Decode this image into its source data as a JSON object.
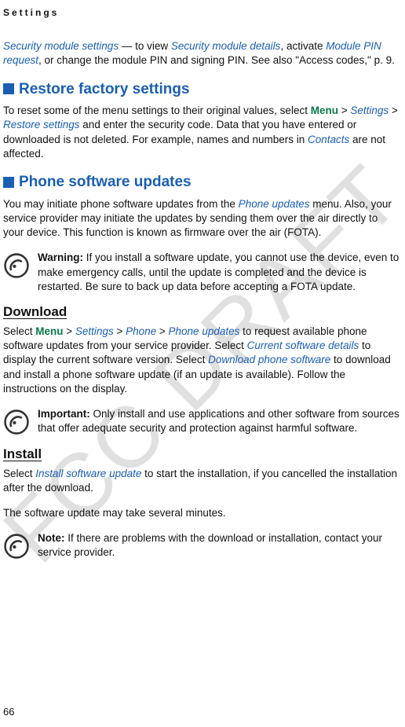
{
  "header": "Settings",
  "watermark": "FCC DRAFT",
  "page_number": "66",
  "intro": {
    "t1": "Security module settings",
    "t2": " — to view ",
    "t3": "Security module details",
    "t4": ", activate ",
    "t5": "Module PIN request",
    "t6": ", or change the module PIN and signing PIN. See also \"Access codes,\" p. 9."
  },
  "restore": {
    "title": "Restore factory settings",
    "p1a": "To reset some of the menu settings to their original values, select ",
    "menu": "Menu",
    "sep": " > ",
    "p1b": "Settings",
    "p1c": "Restore settings",
    "p1d": " and enter the security code. Data that you have entered or downloaded is not deleted. For example, names and numbers in ",
    "p1e": "Contacts",
    "p1f": " are not affected."
  },
  "updates": {
    "title": "Phone software updates",
    "p1a": "You may initiate phone software updates from the ",
    "p1b": "Phone updates",
    "p1c": " menu. Also, your service provider may initiate the updates by sending them over the air directly to your device. This function is known as firmware over the air (FOTA).",
    "warn_label": "Warning: ",
    "warn_text": "If you install a software update, you cannot use the device, even to make emergency calls, until the update is completed and the device is restarted. Be sure to back up data before accepting a FOTA update."
  },
  "download": {
    "title": "Download",
    "p1a": "Select ",
    "menu": "Menu",
    "sep": " > ",
    "p1b": "Settings",
    "p1c": "Phone",
    "p1d": "Phone updates",
    "p1e": " to request available phone software updates from your service provider. Select ",
    "p1f": "Current software details",
    "p1g": " to display the current software version. Select ",
    "p1h": "Download phone software",
    "p1i": " to download and install a phone software update (if an update is available). Follow the instructions on the display.",
    "imp_label": "Important: ",
    "imp_text": "Only install and use applications and other software from sources that offer adequate security and protection against harmful software."
  },
  "install": {
    "title": "Install",
    "p1a": "Select ",
    "p1b": "Install software update",
    "p1c": " to start the installation, if you cancelled the installation after the download.",
    "p2": "The software update may take several minutes.",
    "note_label": "Note: ",
    "note_text": "If there are problems with the download or installation, contact your service provider."
  }
}
